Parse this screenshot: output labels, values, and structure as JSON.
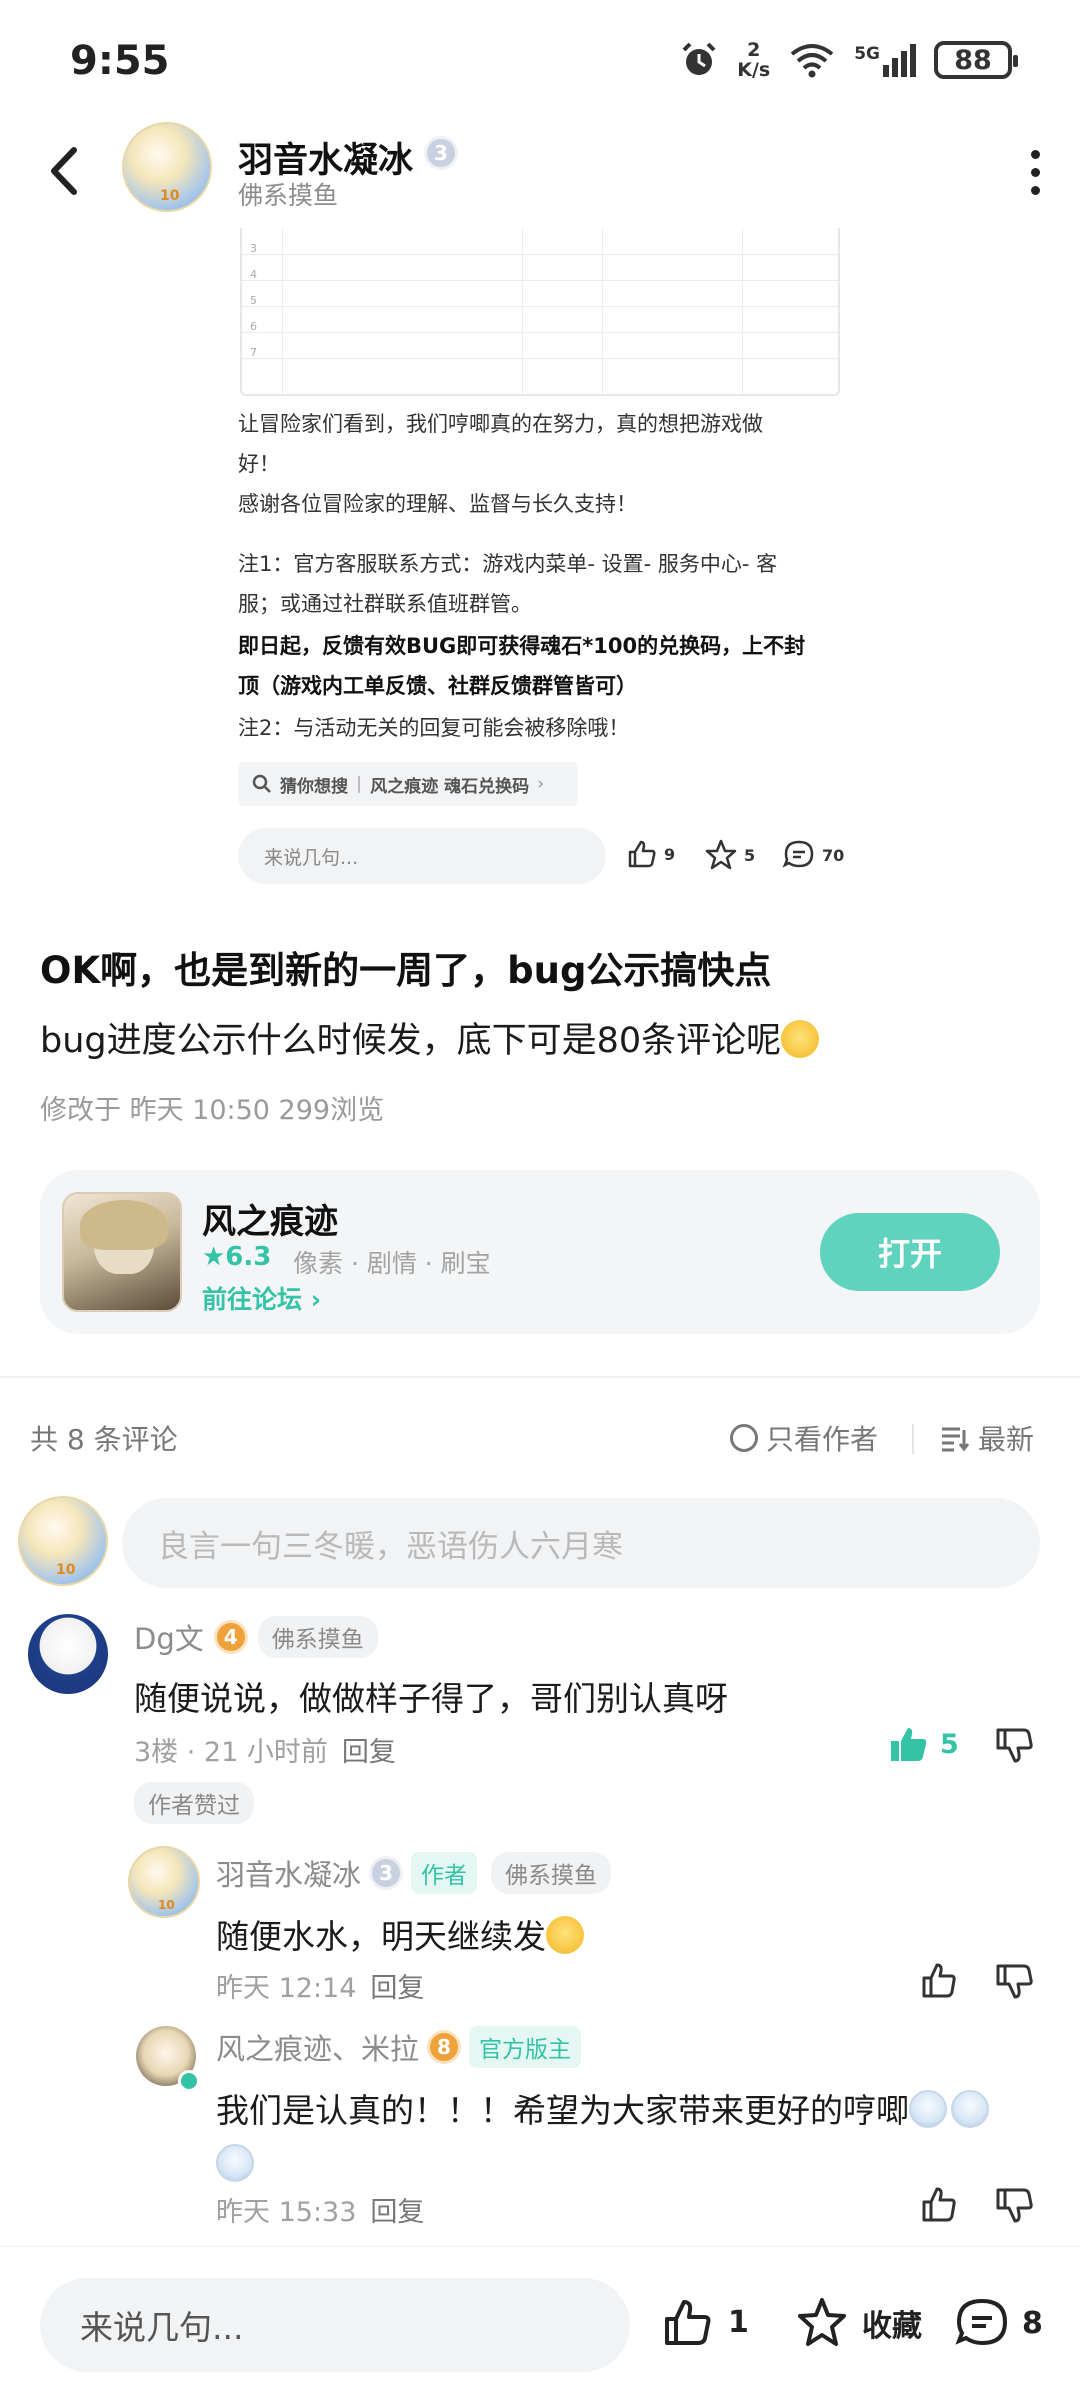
{
  "status_bar": {
    "time": "9:55",
    "net_speed_value": "2",
    "net_speed_unit": "K/s",
    "battery": "88",
    "signal_label": "5G"
  },
  "header": {
    "author_name": "羽音水凝冰",
    "author_level": "3",
    "author_subtitle": "佛系摸鱼",
    "avatar_level": "10"
  },
  "embedded_image": {
    "row_numbers": [
      "3",
      "4",
      "5",
      "6",
      "7"
    ],
    "lines": [
      "让冒险家们看到，我们哼唧真的在努力，真的想把游戏做",
      "好！",
      "感谢各位冒险家的理解、监督与长久支持！",
      "注1：官方客服联系方式：游戏内菜单- 设置- 服务中心- 客",
      "服；或通过社群联系值班群管。",
      "即日起，反馈有效BUG即可获得魂石*100的兑换码，上不封",
      "顶（游戏内工单反馈、社群反馈群管皆可）",
      "注2：与活动无关的回复可能会被移除哦！"
    ],
    "guess_label": "猜你想搜",
    "guess_query": "风之痕迹 魂石兑换码",
    "mini_input_placeholder": "来说几句...",
    "mini_likes": "9",
    "mini_favs": "5",
    "mini_comments": "70"
  },
  "post": {
    "title": "OK啊，也是到新的一周了，bug公示搞快点",
    "body": "bug进度公示什么时候发，底下可是80条评论呢",
    "meta": "修改于 昨天 10:50  299浏览"
  },
  "game_card": {
    "name": "风之痕迹",
    "rating": "★6.3",
    "tags": "像素 · 剧情 · 刷宝",
    "forum_link": "前往论坛 ›",
    "open_button": "打开"
  },
  "comments_header": {
    "count": "共 8 条评论",
    "author_only": "只看作者",
    "sort": "最新",
    "input_placeholder": "良言一句三冬暖，恶语伤人六月寒"
  },
  "comments": [
    {
      "name": "Dg文",
      "level": "4",
      "tag": "佛系摸鱼",
      "text": "随便说说，做做样子得了，哥们别认真呀",
      "meta": "3楼 · 21 小时前",
      "reply": "回复",
      "likes": "5",
      "liked_badge": "作者赞过"
    },
    {
      "name": "羽音水凝冰",
      "level": "3",
      "role": "作者",
      "tag": "佛系摸鱼",
      "text": "随便水水，明天继续发",
      "meta": "昨天 12:14",
      "reply": "回复"
    },
    {
      "name": "风之痕迹、米拉",
      "level": "8",
      "role": "官方版主",
      "text": "我们是认真的！！！希望为大家带来更好的哼唧",
      "meta": "昨天 15:33",
      "reply": "回复"
    }
  ],
  "bottom_bar": {
    "input_placeholder": "来说几句...",
    "likes": "1",
    "favorite_label": "收藏",
    "comments": "8"
  },
  "colors": {
    "accent": "#34c3a6",
    "open_button": "#5fd3bd",
    "muted_text": "#9a9a9a"
  }
}
